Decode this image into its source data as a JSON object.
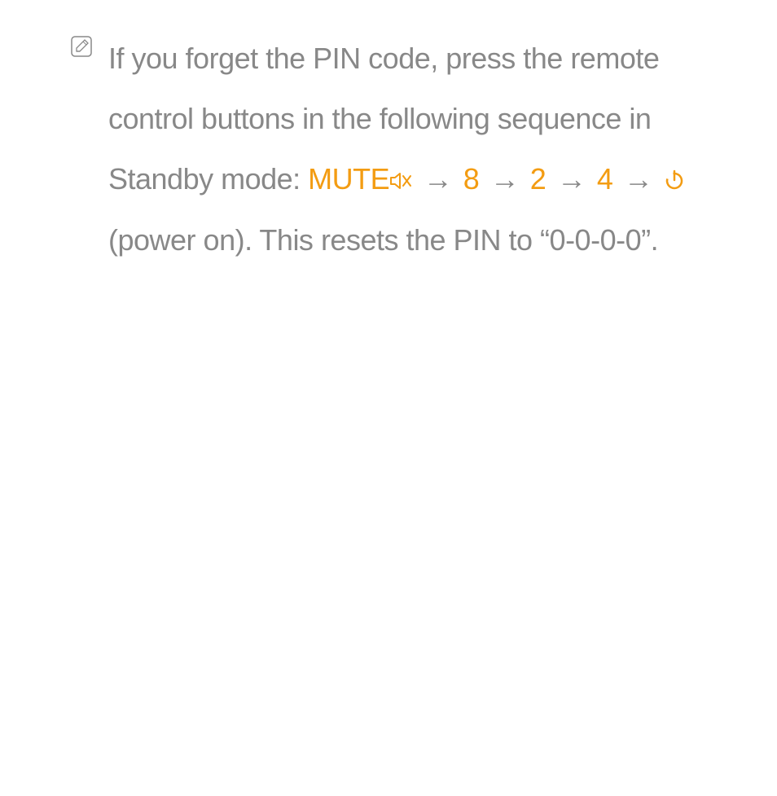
{
  "colors": {
    "text": "#888888",
    "accent": "#f39c12"
  },
  "icons": {
    "note": "note-pencil-icon",
    "mute": "mute-speaker-icon",
    "power": "power-icon"
  },
  "note": {
    "part1": "If you forget the PIN code, press the remote control buttons in the following sequence in Standby mode: ",
    "mute_label": "MUTE",
    "arrow": "→",
    "step1": "8",
    "step2": "2",
    "step3": "4",
    "part2": "(power on). This resets the PIN to “0-0-0-0”."
  }
}
